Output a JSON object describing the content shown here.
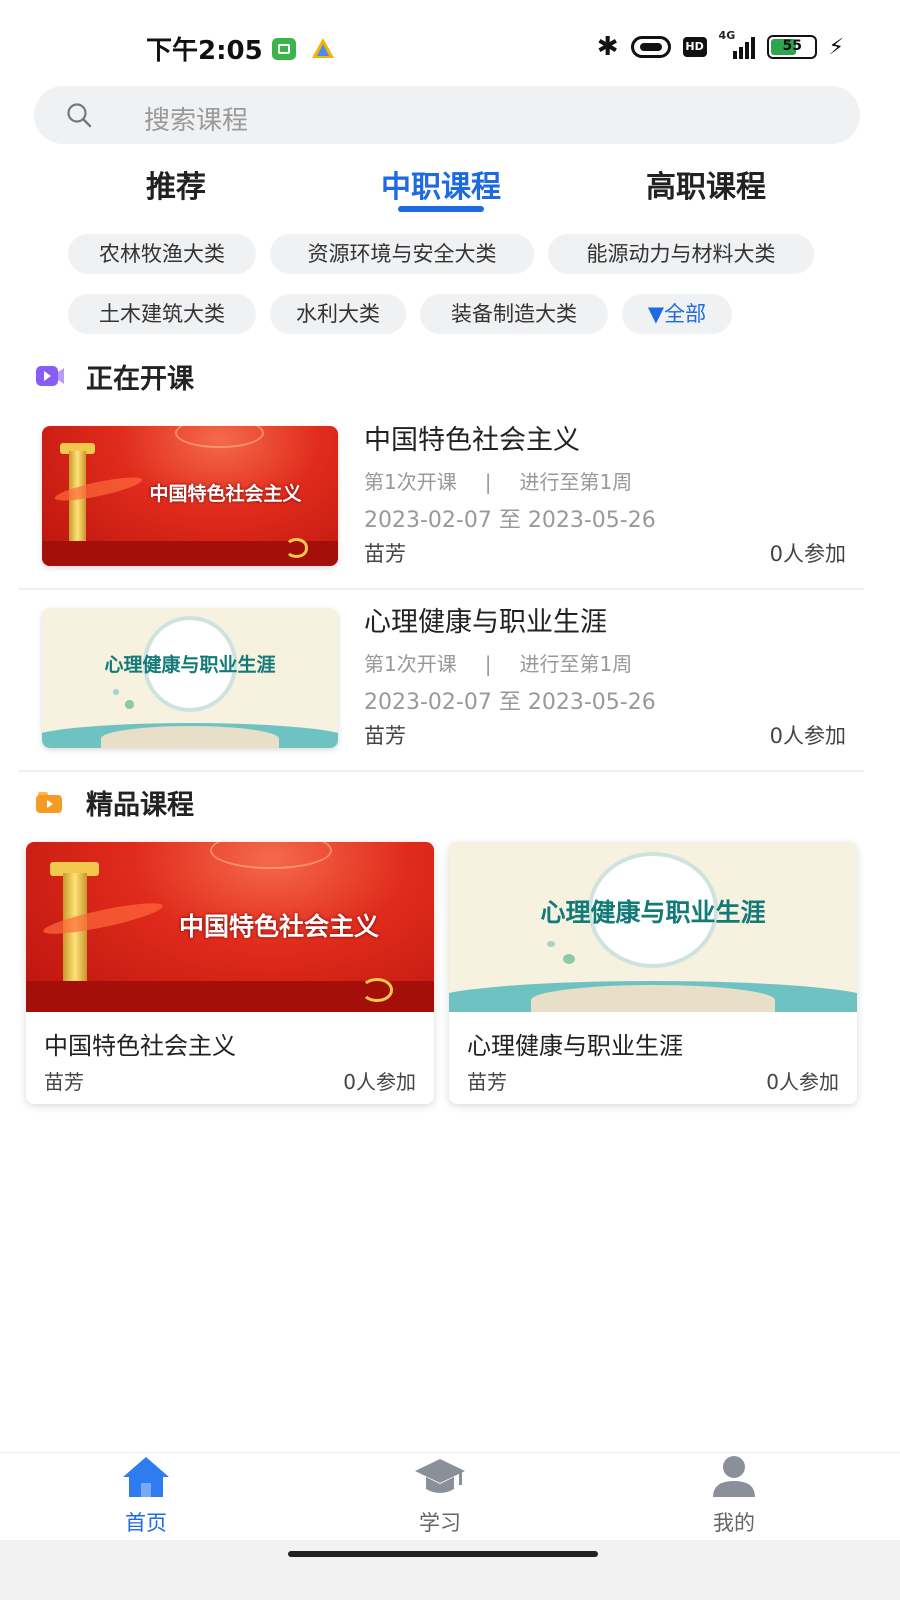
{
  "status_bar": {
    "time": "下午2:05",
    "network": "4G",
    "battery": "55"
  },
  "search": {
    "placeholder": "搜索课程"
  },
  "tabs": [
    {
      "label": "推荐"
    },
    {
      "label": "中职课程"
    },
    {
      "label": "高职课程"
    }
  ],
  "active_tab": "中职课程",
  "categories": [
    {
      "label": "农林牧渔大类"
    },
    {
      "label": "资源环境与安全大类"
    },
    {
      "label": "能源动力与材料大类"
    },
    {
      "label": "土木建筑大类"
    },
    {
      "label": "水利大类"
    },
    {
      "label": "装备制造大类"
    },
    {
      "label": "全部"
    }
  ],
  "colors": {
    "accent": "#1e6ae0",
    "chip_bg": "#f0f1f3",
    "muted_text": "#999999"
  },
  "current_section": {
    "title": "正在开课",
    "courses": [
      {
        "title": "中国特色社会主义",
        "thumb_text": "中国特色社会主义",
        "session": "第1次开课",
        "progress": "进行至第1周",
        "dates": "2023-02-07 至 2023-05-26",
        "teacher": "苗芳",
        "participants": "0人参加"
      },
      {
        "title": "心理健康与职业生涯",
        "thumb_text": "心理健康与职业生涯",
        "session": "第1次开课",
        "progress": "进行至第1周",
        "dates": "2023-02-07 至 2023-05-26",
        "teacher": "苗芳",
        "participants": "0人参加"
      }
    ],
    "meta_separator": "|"
  },
  "featured_section": {
    "title": "精品课程",
    "courses": [
      {
        "title": "中国特色社会主义",
        "thumb_text": "中国特色社会主义",
        "teacher": "苗芳",
        "participants": "0人参加"
      },
      {
        "title": "心理健康与职业生涯",
        "thumb_text": "心理健康与职业生涯",
        "teacher": "苗芳",
        "participants": "0人参加"
      }
    ]
  },
  "bottom_nav": [
    {
      "label": "首页",
      "icon": "home-icon"
    },
    {
      "label": "学习",
      "icon": "graduation-cap-icon"
    },
    {
      "label": "我的",
      "icon": "user-icon"
    }
  ]
}
